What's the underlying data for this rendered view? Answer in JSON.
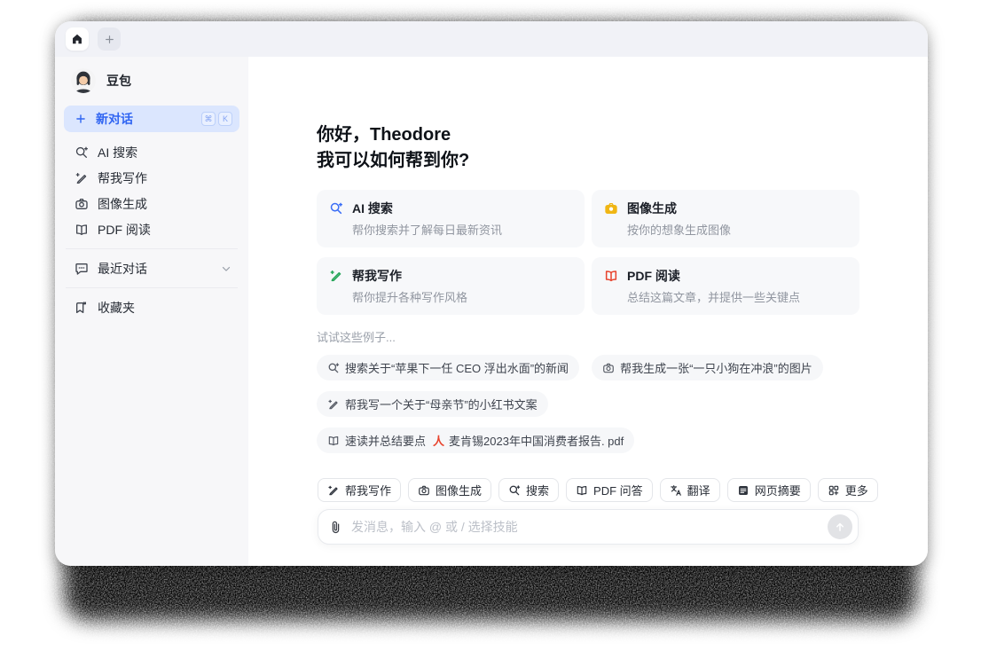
{
  "colors": {
    "accent_blue": "#3065f2",
    "new_chat_bg": "#dbe6fe",
    "sidebar_bg": "#f7f7f9",
    "tabbar_bg": "#f1f2f7",
    "card_bg": "#f7f8fa",
    "card_icon_search": "#3b6ef6",
    "card_icon_image": "#f0b614",
    "card_icon_write": "#27a65a",
    "card_icon_pdf": "#e8442e",
    "send_button_bg": "#e2e3e6"
  },
  "tabbar": {
    "tabs": [
      {
        "icon": "home-icon",
        "active": true
      },
      {
        "icon": "plus-icon",
        "active": false
      }
    ]
  },
  "sidebar": {
    "profile": {
      "name": "豆包",
      "avatar": "doubao-avatar"
    },
    "new_chat": {
      "icon": "plus-icon",
      "label": "新对话",
      "shortcut_keys": [
        "⌘",
        "K"
      ]
    },
    "items": [
      {
        "icon": "ai-search-icon",
        "label": "AI 搜索"
      },
      {
        "icon": "write-icon",
        "label": "帮我写作"
      },
      {
        "icon": "image-gen-icon",
        "label": "图像生成"
      },
      {
        "icon": "pdf-read-icon",
        "label": "PDF 阅读"
      }
    ],
    "sections": [
      {
        "icon": "chat-bubble-icon",
        "label": "最近对话",
        "chevron": "chevron-down-icon"
      },
      {
        "icon": "bookmark-icon",
        "label": "收藏夹"
      }
    ]
  },
  "main": {
    "greeting_line1": "你好，Theodore",
    "greeting_line2": "我可以如何帮到你?",
    "feature_cards": [
      {
        "icon": "ai-search-icon",
        "title": "AI 搜索",
        "description": "帮你搜索并了解每日最新资讯"
      },
      {
        "icon": "image-gen-icon",
        "title": "图像生成",
        "description": "按你的想象生成图像"
      },
      {
        "icon": "write-icon",
        "title": "帮我写作",
        "description": "帮你提升各种写作风格"
      },
      {
        "icon": "pdf-read-icon",
        "title": "PDF 阅读",
        "description": "总结这篇文章，并提供一些关键点"
      }
    ],
    "examples_label": "试试这些例子...",
    "example_chips": [
      {
        "icon": "ai-search-icon",
        "text": "搜索关于“苹果下一任 CEO 浮出水面”的新闻"
      },
      {
        "icon": "image-gen-icon",
        "text": "帮我生成一张“一只小狗在冲浪”的图片"
      },
      {
        "icon": "write-icon",
        "text": "帮我写一个关于“母亲节”的小红书文案"
      },
      {
        "icon": "pdf-read-icon",
        "text": "速读并总结要点",
        "attachment": {
          "icon": "pdf-file-icon",
          "mark": "人",
          "name": "麦肯锡2023年中国消费者报告. pdf"
        }
      }
    ],
    "skills": [
      {
        "icon": "write-icon",
        "label": "帮我写作"
      },
      {
        "icon": "image-gen-icon",
        "label": "图像生成"
      },
      {
        "icon": "ai-search-icon",
        "label": "搜索"
      },
      {
        "icon": "pdf-read-icon",
        "label": "PDF 问答"
      },
      {
        "icon": "translate-icon",
        "label": "翻译"
      },
      {
        "icon": "webpage-icon",
        "label": "网页摘要"
      },
      {
        "icon": "more-icon",
        "label": "更多"
      }
    ],
    "composer": {
      "attach_icon": "paperclip-icon",
      "placeholder": "发消息，输入 @ 或 / 选择技能",
      "send_icon": "arrow-up-icon"
    }
  }
}
